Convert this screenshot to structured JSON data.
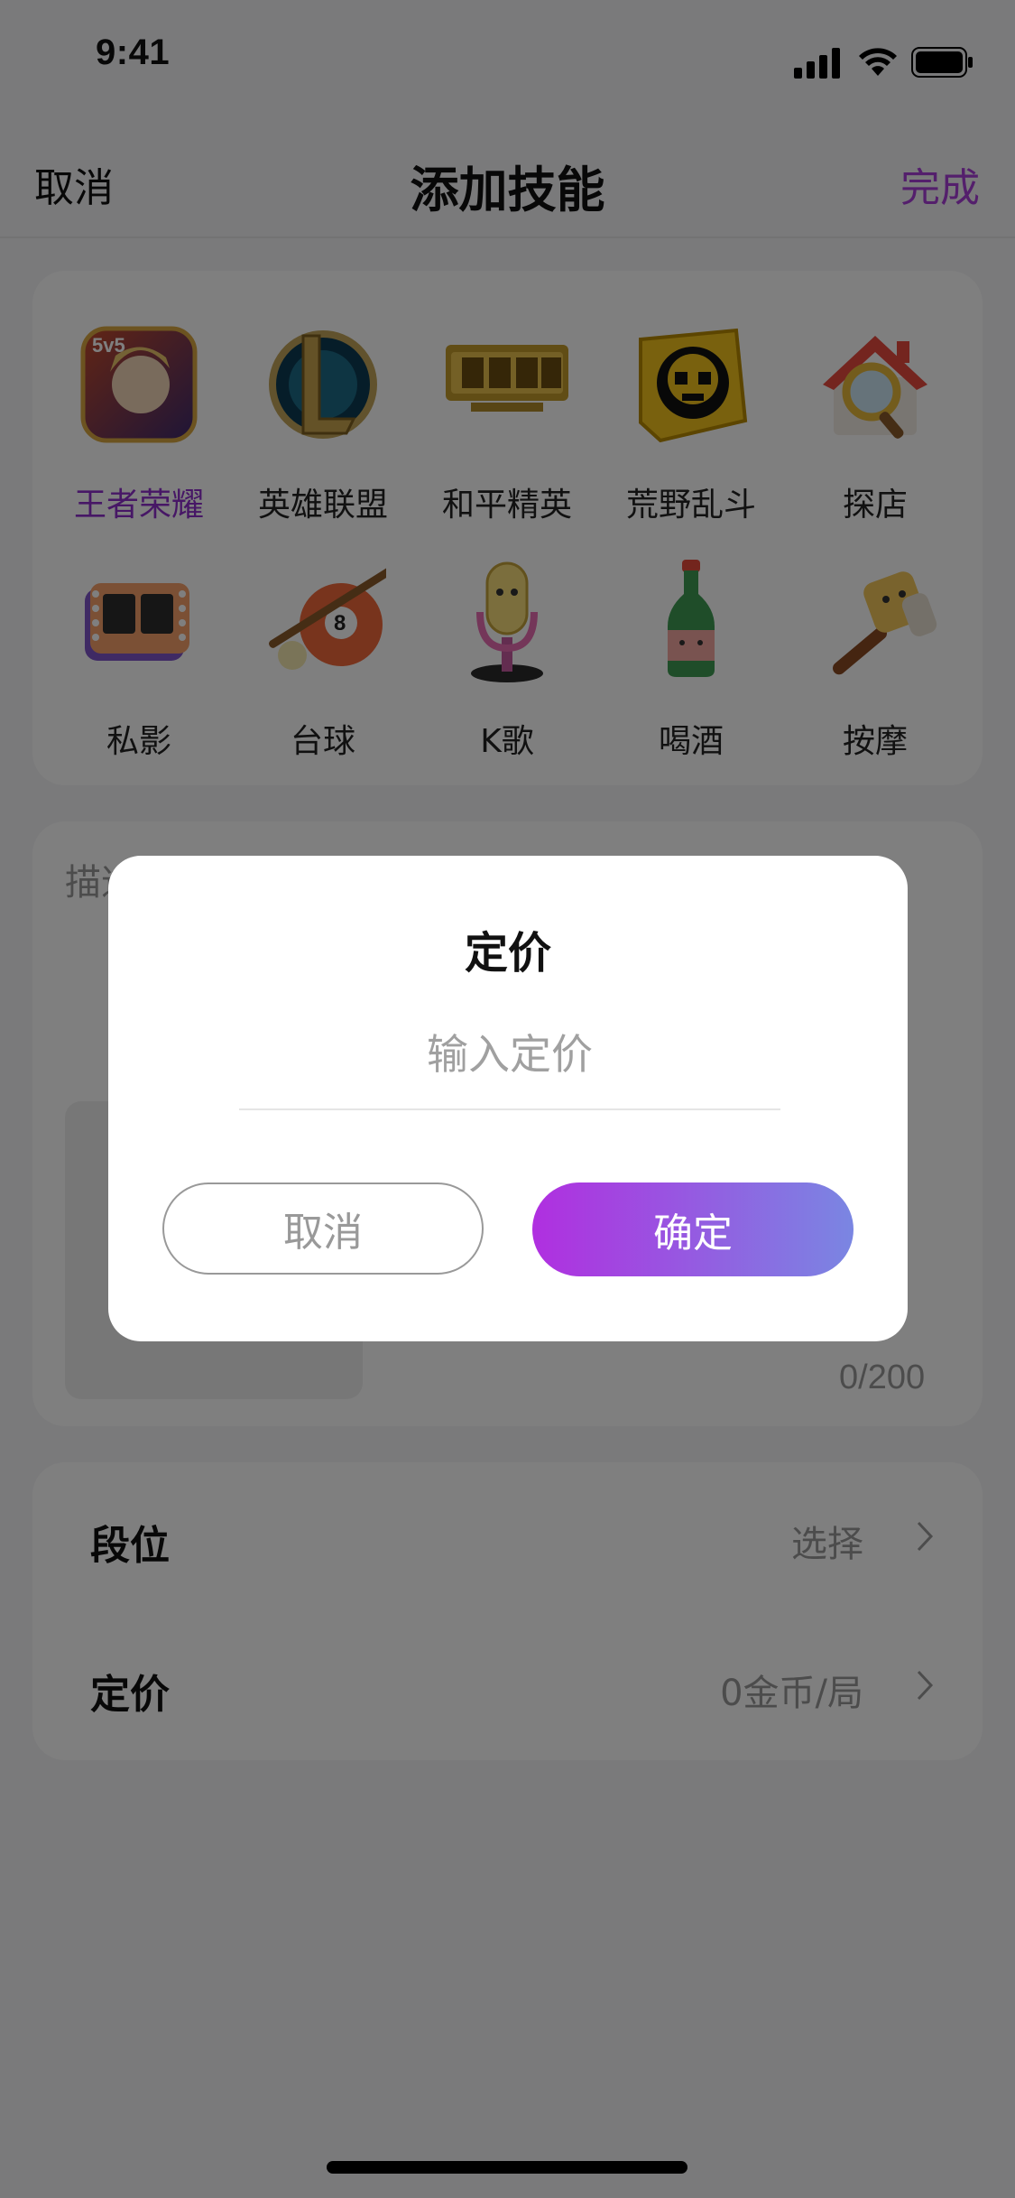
{
  "status_bar": {
    "time": "9:41"
  },
  "nav": {
    "cancel": "取消",
    "title": "添加技能",
    "done": "完成"
  },
  "skills": [
    {
      "label": "王者荣耀",
      "icon": "honor-of-kings-icon",
      "selected": true
    },
    {
      "label": "英雄联盟",
      "icon": "league-of-legends-icon",
      "selected": false
    },
    {
      "label": "和平精英",
      "icon": "game-for-peace-icon",
      "selected": false
    },
    {
      "label": "荒野乱斗",
      "icon": "brawl-stars-icon",
      "selected": false
    },
    {
      "label": "探店",
      "icon": "house-magnifier-icon",
      "selected": false
    },
    {
      "label": "私影",
      "icon": "film-reel-icon",
      "selected": false
    },
    {
      "label": "台球",
      "icon": "billiards-icon",
      "selected": false
    },
    {
      "label": "K歌",
      "icon": "microphone-icon",
      "selected": false
    },
    {
      "label": "喝酒",
      "icon": "bottle-icon",
      "selected": false
    },
    {
      "label": "按摩",
      "icon": "massage-hammer-icon",
      "selected": false
    }
  ],
  "description": {
    "placeholder": "描述",
    "count": "0/200"
  },
  "rows": [
    {
      "label": "段位",
      "value": "选择"
    },
    {
      "label": "定价",
      "value": "0金币/局"
    }
  ],
  "dialog": {
    "title": "定价",
    "input_placeholder": "输入定价",
    "cancel": "取消",
    "confirm": "确定"
  },
  "colors": {
    "accent": "#a83fd9",
    "gradient_start": "#b02fe0",
    "gradient_end": "#7a86e2"
  }
}
